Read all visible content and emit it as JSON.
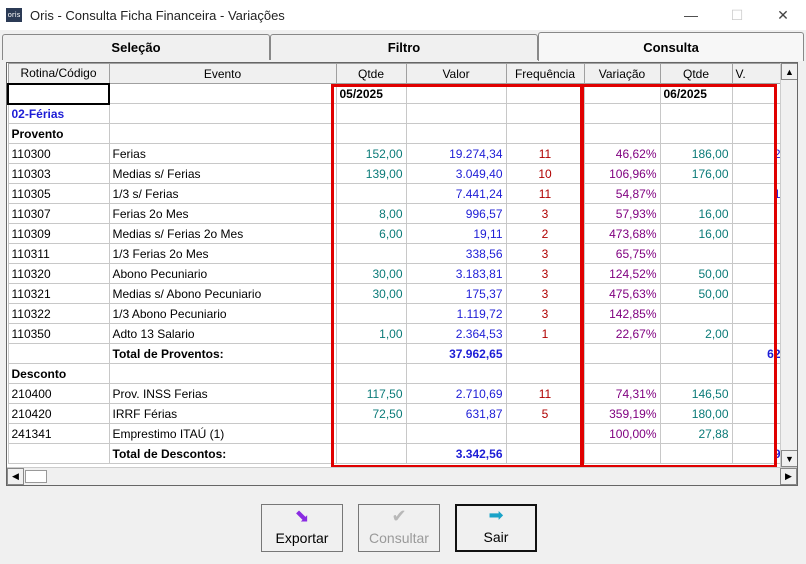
{
  "window": {
    "app_icon_text": "oris",
    "title": "Oris - Consulta Ficha Financeira - Variações",
    "minimize": "—",
    "maximize": "☐",
    "close": "✕"
  },
  "tabs": [
    {
      "label": "Seleção"
    },
    {
      "label": "Filtro"
    },
    {
      "label": "Consulta"
    }
  ],
  "grid": {
    "headers": [
      "Rotina/Código",
      "Evento",
      "Qtde",
      "Valor",
      "Frequência",
      "Variação",
      "Qtde",
      "V."
    ],
    "period1": "05/2025",
    "period2": "06/2025",
    "rows": [
      {
        "code": "02-Férias",
        "kind": "group"
      },
      {
        "code": "Provento",
        "kind": "section"
      },
      {
        "code": "110300",
        "evento": "Ferias",
        "qtde": "152,00",
        "valor": "19.274,34",
        "freq": "11",
        "variacao": "46,62%",
        "qtde2": "186,00",
        "v2": "2"
      },
      {
        "code": "110303",
        "evento": "Medias s/ Ferias",
        "qtde": "139,00",
        "valor": "3.049,40",
        "freq": "10",
        "variacao": "106,96%",
        "qtde2": "176,00",
        "v2": ""
      },
      {
        "code": "110305",
        "evento": "1/3 s/ Ferias",
        "qtde": "",
        "valor": "7.441,24",
        "freq": "11",
        "variacao": "54,87%",
        "qtde2": "",
        "v2": "1"
      },
      {
        "code": "110307",
        "evento": "Ferias 2o Mes",
        "qtde": "8,00",
        "valor": "996,57",
        "freq": "3",
        "variacao": "57,93%",
        "qtde2": "16,00",
        "v2": ""
      },
      {
        "code": "110309",
        "evento": "Medias s/ Ferias 2o Mes",
        "qtde": "6,00",
        "valor": "19,11",
        "freq": "2",
        "variacao": "473,68%",
        "qtde2": "16,00",
        "v2": ""
      },
      {
        "code": "110311",
        "evento": "1/3 Ferias 2o Mes",
        "qtde": "",
        "valor": "338,56",
        "freq": "3",
        "variacao": "65,75%",
        "qtde2": "",
        "v2": ""
      },
      {
        "code": "110320",
        "evento": "Abono Pecuniario",
        "qtde": "30,00",
        "valor": "3.183,81",
        "freq": "3",
        "variacao": "124,52%",
        "qtde2": "50,00",
        "v2": ""
      },
      {
        "code": "110321",
        "evento": "Medias s/ Abono Pecuniario",
        "qtde": "30,00",
        "valor": "175,37",
        "freq": "3",
        "variacao": "475,63%",
        "qtde2": "50,00",
        "v2": ""
      },
      {
        "code": "110322",
        "evento": "1/3 Abono Pecuniario",
        "qtde": "",
        "valor": "1.119,72",
        "freq": "3",
        "variacao": "142,85%",
        "qtde2": "",
        "v2": ""
      },
      {
        "code": "110350",
        "evento": "Adto 13 Salario",
        "qtde": "1,00",
        "valor": "2.364,53",
        "freq": "1",
        "variacao": "22,67%",
        "qtde2": "2,00",
        "v2": ""
      },
      {
        "code": "",
        "evento": "Total de Proventos:",
        "valor": "37.962,65",
        "v2": "62",
        "kind": "total"
      },
      {
        "code": "Desconto",
        "kind": "section"
      },
      {
        "code": "210400",
        "evento": "Prov. INSS Ferias",
        "qtde": "117,50",
        "valor": "2.710,69",
        "freq": "11",
        "variacao": "74,31%",
        "qtde2": "146,50",
        "v2": ""
      },
      {
        "code": "210420",
        "evento": "IRRF Férias",
        "qtde": "72,50",
        "valor": "631,87",
        "freq": "5",
        "variacao": "359,19%",
        "qtde2": "180,00",
        "v2": ""
      },
      {
        "code": "241341",
        "evento": "Emprestimo ITAÚ (1)",
        "qtde": "",
        "valor": "",
        "freq": "",
        "variacao": "100,00%",
        "qtde2": "27,88",
        "v2": ""
      },
      {
        "code": "",
        "evento": "Total de Descontos:",
        "valor": "3.342,56",
        "v2": "9",
        "kind": "total"
      }
    ]
  },
  "buttons": {
    "exportar": "Exportar",
    "consultar": "Consultar",
    "sair": "Sair"
  },
  "colors": {
    "qtde": "#0a7a78",
    "valor": "#1d1dd6",
    "freq": "#b00000",
    "variacao": "#800080",
    "highlight": "#e00000"
  }
}
